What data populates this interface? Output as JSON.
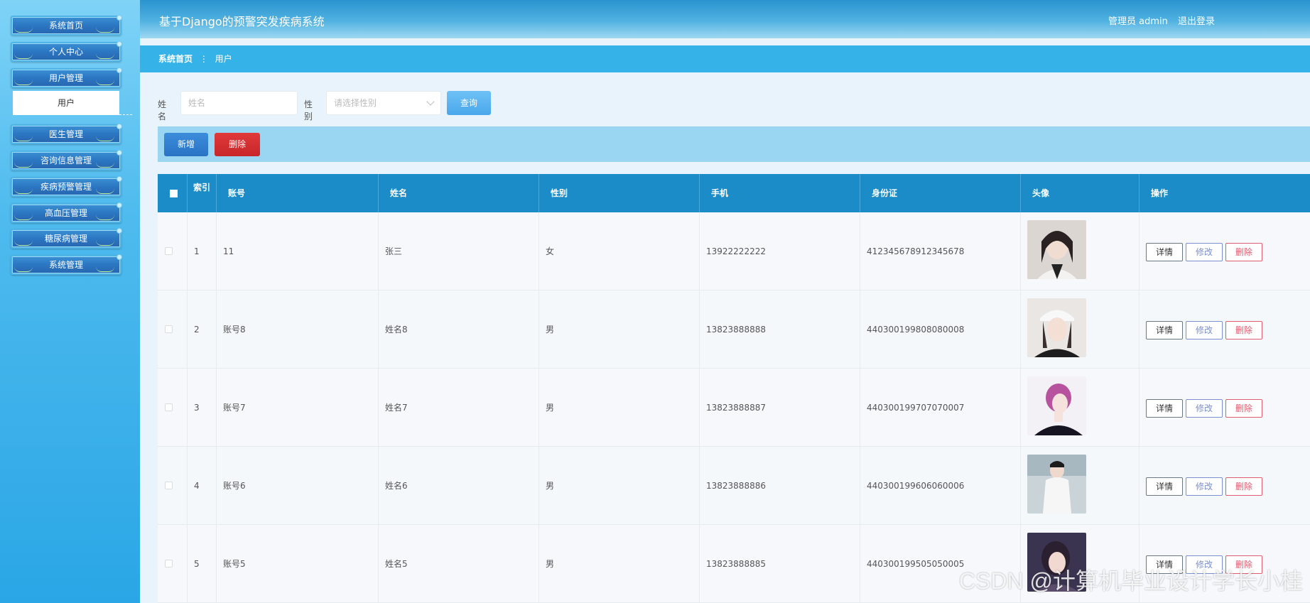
{
  "header": {
    "title": "基于Django的预警突发疾病系统",
    "user_label": "管理员 admin",
    "logout_label": "退出登录"
  },
  "sidebar": {
    "items": [
      {
        "label": "系统首页"
      },
      {
        "label": "个人中心"
      },
      {
        "label": "用户管理"
      },
      {
        "label": "医生管理"
      },
      {
        "label": "咨询信息管理"
      },
      {
        "label": "疾病预警管理"
      },
      {
        "label": "高血压管理"
      },
      {
        "label": "糖尿病管理"
      },
      {
        "label": "系统管理"
      }
    ],
    "active_sub": "用户"
  },
  "breadcrumb": {
    "home": "系统首页",
    "separator": "⋮",
    "current": "用户"
  },
  "search": {
    "name_label": "姓名",
    "name_placeholder": "姓名",
    "gender_label": "性别",
    "gender_placeholder": "请选择性别",
    "query_label": "查询"
  },
  "actions": {
    "add_label": "新增",
    "delete_label": "删除"
  },
  "table": {
    "columns": {
      "index": "索引",
      "account": "账号",
      "name": "姓名",
      "gender": "性别",
      "phone": "手机",
      "id_card": "身份证",
      "avatar": "头像",
      "ops": "操作"
    },
    "op_labels": {
      "detail": "详情",
      "edit": "修改",
      "delete": "删除"
    },
    "rows": [
      {
        "index": "1",
        "account": "11",
        "name": "张三",
        "gender": "女",
        "phone": "13922222222",
        "id_card": "412345678912345678"
      },
      {
        "index": "2",
        "account": "账号8",
        "name": "姓名8",
        "gender": "男",
        "phone": "13823888888",
        "id_card": "440300199808080008"
      },
      {
        "index": "3",
        "account": "账号7",
        "name": "姓名7",
        "gender": "男",
        "phone": "13823888887",
        "id_card": "440300199707070007"
      },
      {
        "index": "4",
        "account": "账号6",
        "name": "姓名6",
        "gender": "男",
        "phone": "13823888886",
        "id_card": "440300199606060006"
      },
      {
        "index": "5",
        "account": "账号5",
        "name": "姓名5",
        "gender": "男",
        "phone": "13823888885",
        "id_card": "440300199505050005"
      }
    ]
  },
  "watermark": "CSDN @计算机毕业设计学长小桂"
}
